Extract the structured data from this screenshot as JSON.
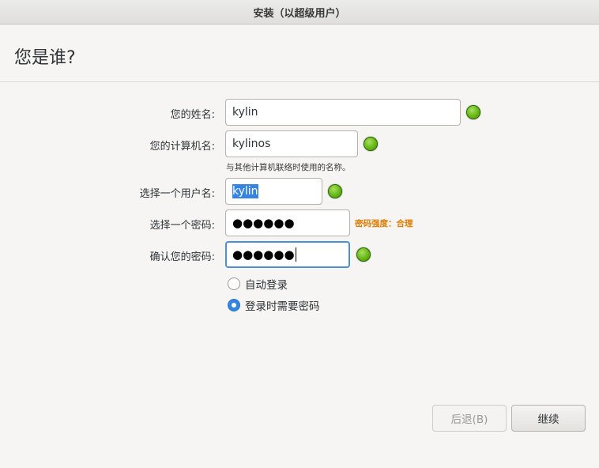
{
  "window": {
    "title": "安装（以超级用户）"
  },
  "page": {
    "title": "您是谁?"
  },
  "form": {
    "name_label": "您的姓名:",
    "name_value": "kylin",
    "computer_label": "您的计算机名:",
    "computer_value": "kylinos",
    "computer_hint": "与其他计算机联络时使用的名称。",
    "username_label": "选择一个用户名:",
    "username_value": "kylin",
    "password_label": "选择一个密码:",
    "password_value": "●●●●●●",
    "password_strength": "密码强度：合理",
    "confirm_label": "确认您的密码:",
    "confirm_value": "●●●●●●"
  },
  "login_options": [
    {
      "label": "自动登录",
      "checked": false
    },
    {
      "label": "登录时需要密码",
      "checked": true
    }
  ],
  "buttons": {
    "back": "后退(B)",
    "next": "继续"
  },
  "icons": {
    "valid": "green-check-icon"
  },
  "colors": {
    "accent": "#3584e4",
    "strength": "#e07b00",
    "valid": "#6cbc1a"
  }
}
